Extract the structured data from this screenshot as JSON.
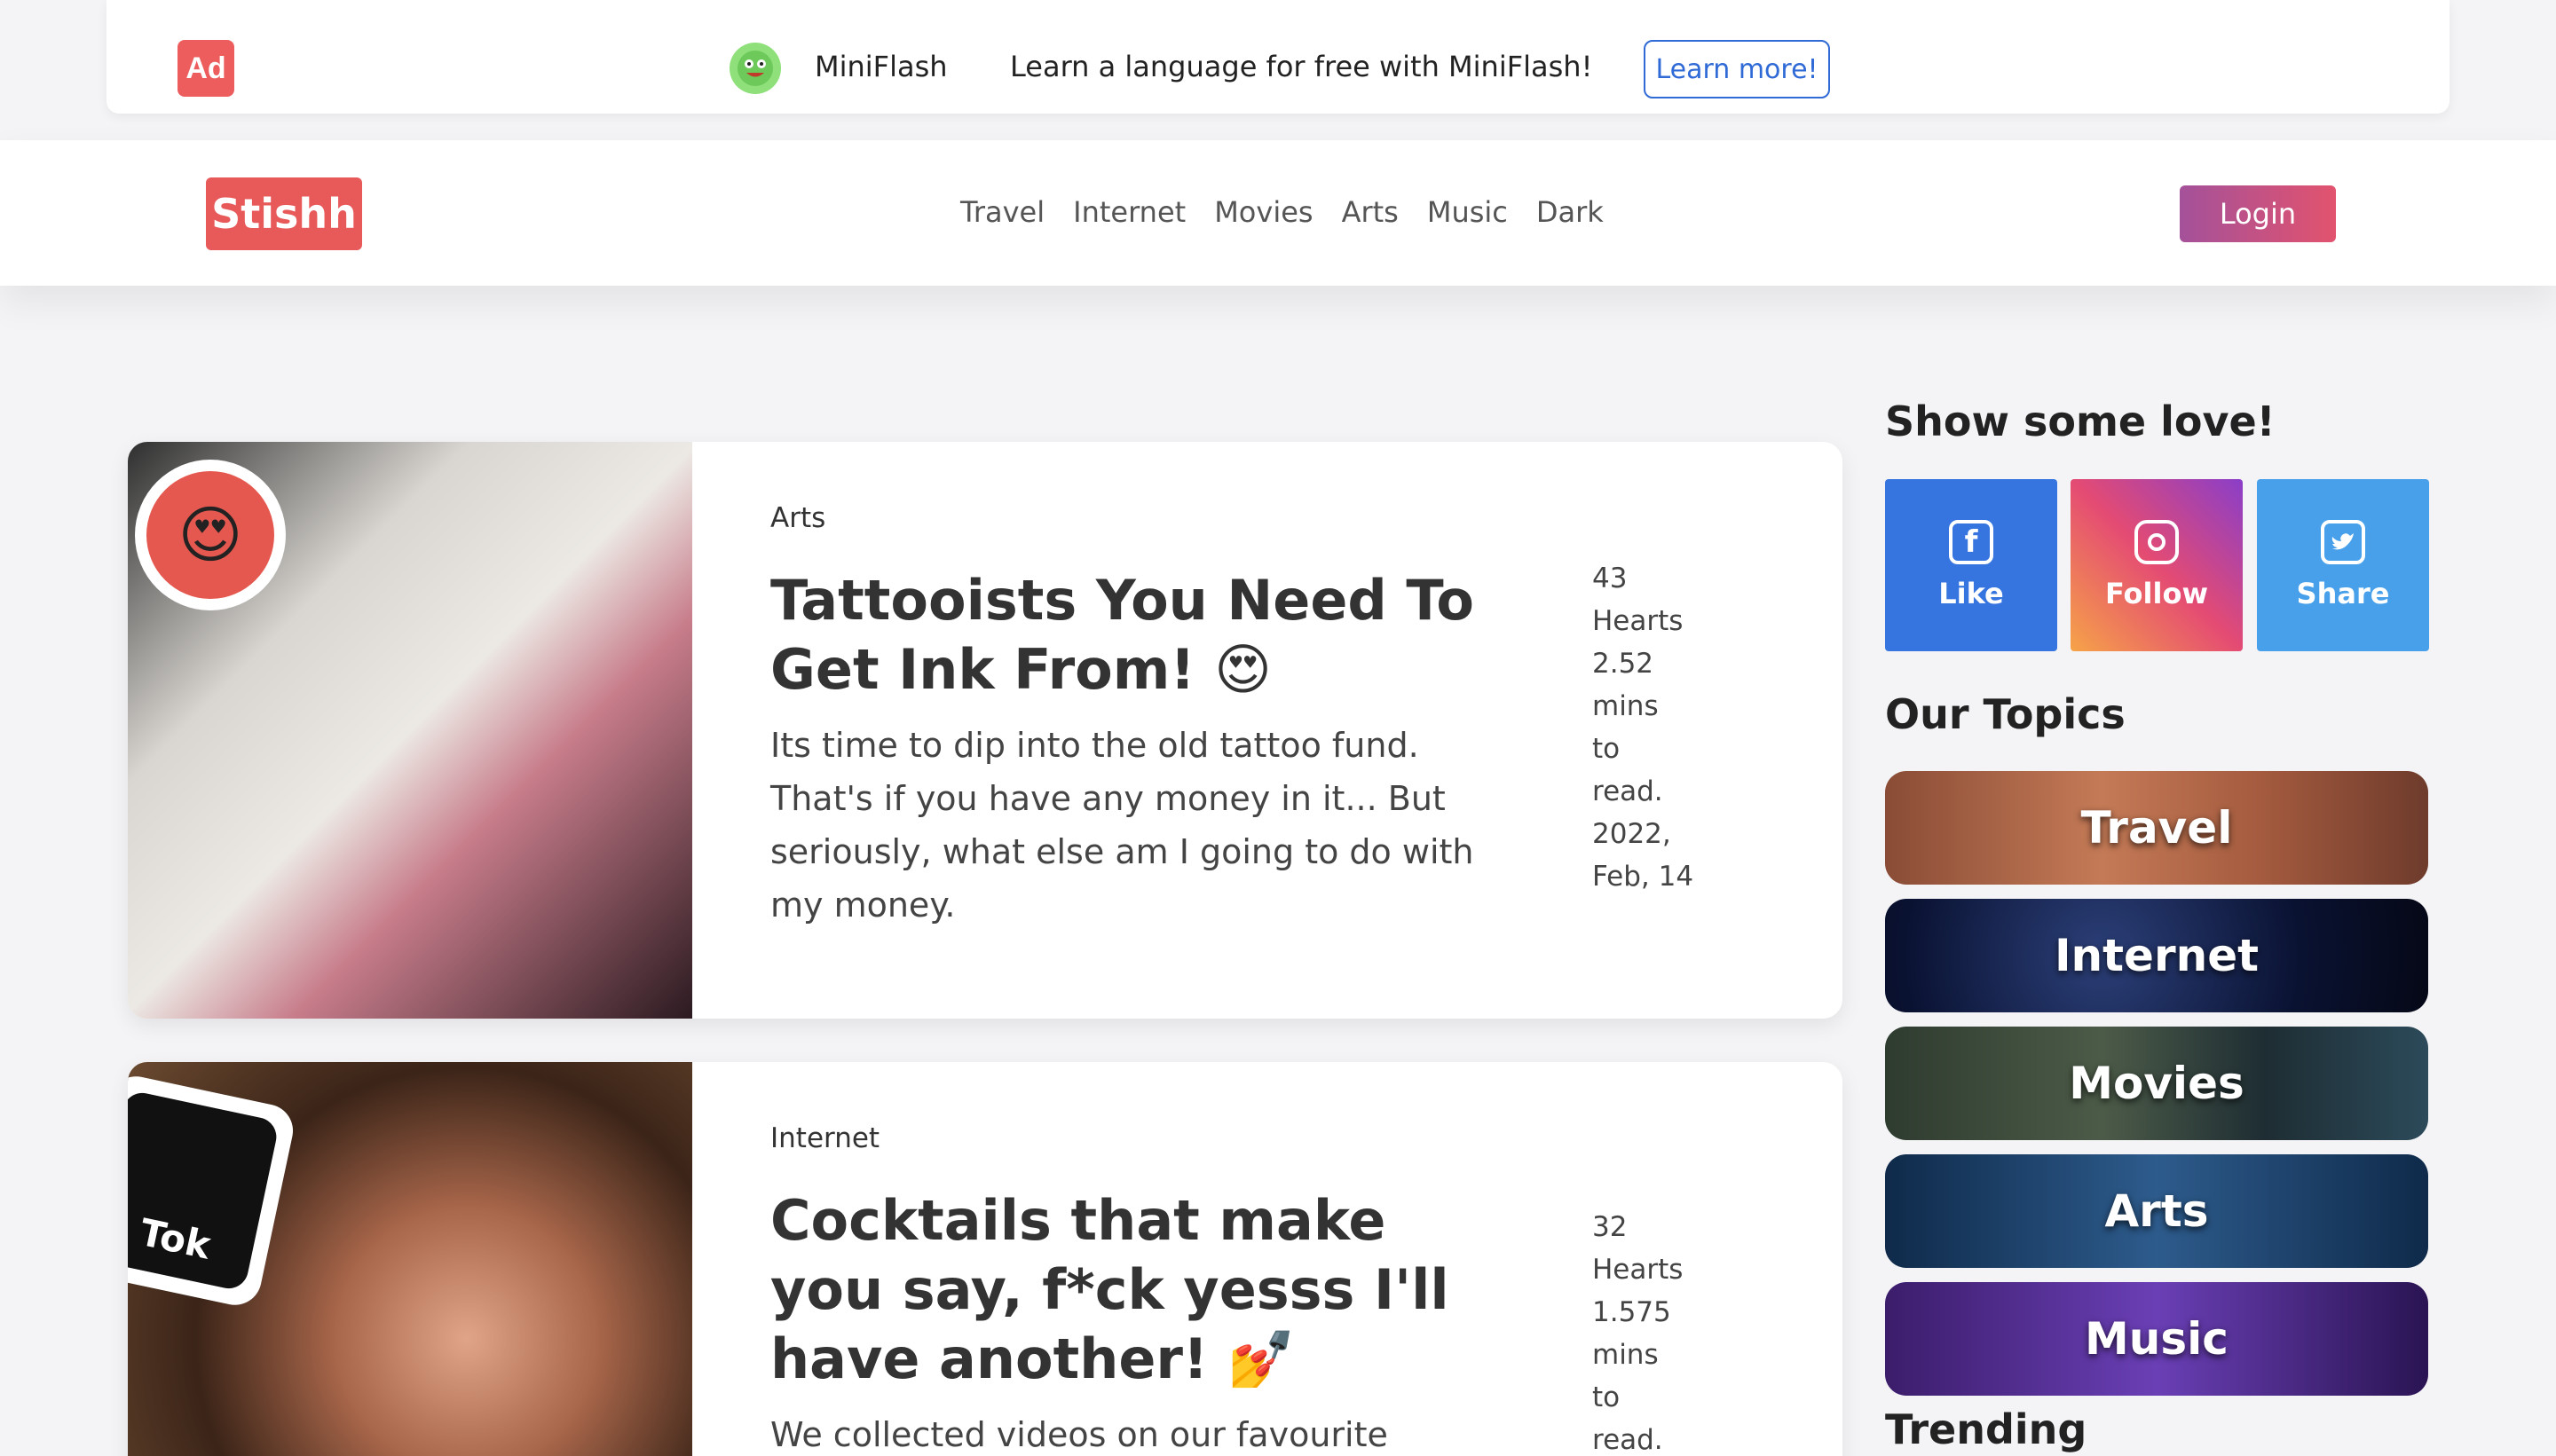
{
  "ad": {
    "badge": "Ad",
    "brand": "MiniFlash",
    "text": "Learn a language for free with MiniFlash!",
    "cta": "Learn more!"
  },
  "header": {
    "logo": "Stishh",
    "nav": [
      "Travel",
      "Internet",
      "Movies",
      "Arts",
      "Music",
      "Dark"
    ],
    "login": "Login"
  },
  "posts": [
    {
      "category": "Arts",
      "title": "Tattooists You Need To Get Ink From! 😍",
      "description": "Its time to dip into the old tattoo fund. That's if you have any money in it... But seriously, what else am I going to do with my money.",
      "meta": [
        "43",
        "Hearts",
        "2.52",
        "mins",
        "to",
        "read.",
        "2022,",
        "Feb, 14"
      ]
    },
    {
      "category": "Internet",
      "title": "Cocktails that make you say, f*ck yesss I'll have another! 💅",
      "description": "We collected videos on our favourite",
      "meta": [
        "32",
        "Hearts",
        "1.575",
        "mins",
        "to",
        "read."
      ],
      "badge": "Tok"
    }
  ],
  "sidebar": {
    "love_heading": "Show some love!",
    "social": [
      {
        "label": "Like",
        "icon": "facebook-icon"
      },
      {
        "label": "Follow",
        "icon": "instagram-icon"
      },
      {
        "label": "Share",
        "icon": "twitter-icon"
      }
    ],
    "topics_heading": "Our Topics",
    "topics": [
      "Travel",
      "Internet",
      "Movies",
      "Arts",
      "Music"
    ],
    "trending_heading": "Trending"
  },
  "colors": {
    "brand_red": "#e85a5a",
    "link_blue": "#2f6ad6",
    "facebook": "#3675e0",
    "twitter": "#48a0ea"
  }
}
